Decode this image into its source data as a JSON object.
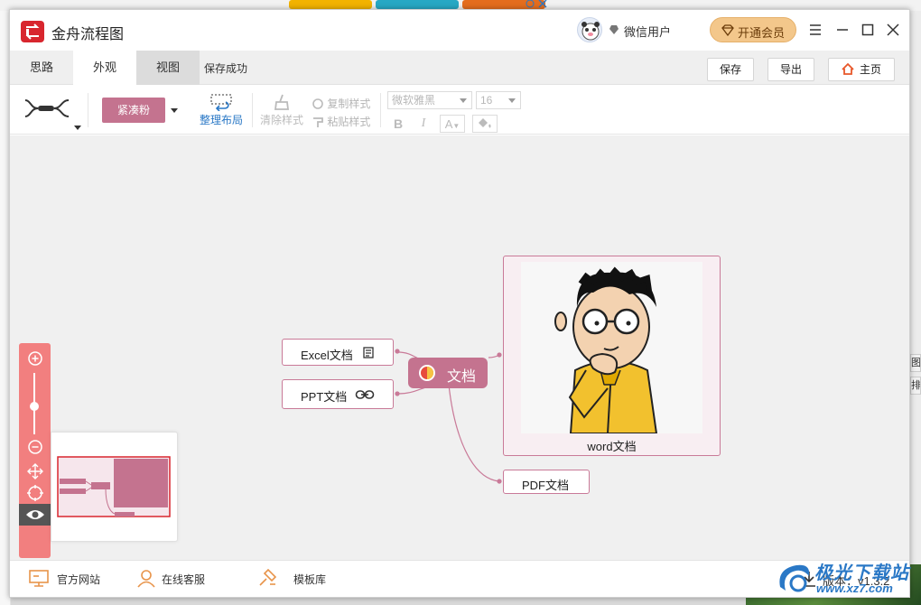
{
  "window": {
    "title": "金舟流程图",
    "user_name": "微信用户",
    "vip_label": "开通会员"
  },
  "tabs": [
    {
      "label": "思路"
    },
    {
      "label": "外观",
      "active": true
    },
    {
      "label": "视图"
    }
  ],
  "status": "保存成功",
  "top_buttons": {
    "save": "保存",
    "export": "导出",
    "home": "主页"
  },
  "toolbar": {
    "theme": "紧凑粉",
    "tidy_layout": "整理布局",
    "clear_style": "清除样式",
    "copy_style": "复制样式",
    "paste_style": "粘贴样式",
    "font_family": "微软雅黑",
    "font_size": "16",
    "bold": "B",
    "italic": "I",
    "font_color": "A"
  },
  "mindmap": {
    "root": "文档",
    "nodes": [
      "Excel文档",
      "PPT文档",
      "word文档",
      "PDF文档"
    ]
  },
  "footer": {
    "website": "官方网站",
    "support": "在线客服",
    "templates": "模板库",
    "version": "版本：v1.3.2"
  },
  "watermark": {
    "title": "极光下载站",
    "url": "www.xz7.com"
  },
  "background": {
    "right_frag_1": "图",
    "right_frag_2": "排"
  },
  "colors": {
    "accent": "#c4738f",
    "brand_red": "#d8262e",
    "zoom_panel": "#f27f7f",
    "vip": "#f3c78b"
  }
}
